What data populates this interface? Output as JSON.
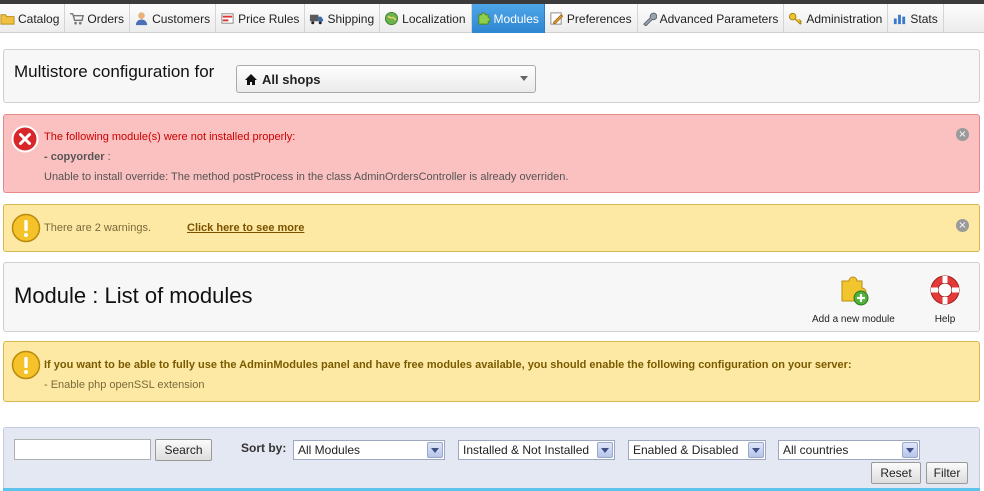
{
  "menu": {
    "tabs": [
      {
        "label": "Catalog",
        "icon": "folder-icon"
      },
      {
        "label": "Orders",
        "icon": "cart-icon"
      },
      {
        "label": "Customers",
        "icon": "user-icon"
      },
      {
        "label": "Price Rules",
        "icon": "price-tag-icon"
      },
      {
        "label": "Shipping",
        "icon": "truck-icon"
      },
      {
        "label": "Localization",
        "icon": "globe-icon"
      },
      {
        "label": "Modules",
        "icon": "puzzle-icon"
      },
      {
        "label": "Preferences",
        "icon": "preferences-icon"
      },
      {
        "label": "Advanced Parameters",
        "icon": "wrench-icon"
      },
      {
        "label": "Administration",
        "icon": "key-icon"
      },
      {
        "label": "Stats",
        "icon": "bar-chart-icon"
      }
    ],
    "active_tab": "Modules"
  },
  "multistore": {
    "title": "Multistore configuration for",
    "selected": "All shops",
    "icon": "home-icon"
  },
  "error": {
    "line1": "The following module(s) were not installed properly:",
    "module_name": "- copyorder",
    "module_suffix": " :",
    "line3": "Unable to install override: The method postProcess in the class AdminOrdersController is already overriden.",
    "colors": {
      "background": "#fbc0c0",
      "text": "#cc0000"
    }
  },
  "warning": {
    "text": "There are 2 warnings.",
    "link": "Click here to see more"
  },
  "module_list": {
    "title": "Module : List of modules",
    "add_label": "Add a new module",
    "help_label": "Help"
  },
  "info": {
    "line1": "If you want to be able to fully use the AdminModules panel and have free modules available, you should enable the following configuration on your server:",
    "line2": "- Enable php openSSL extension"
  },
  "filter": {
    "search_value": "",
    "search_button": "Search",
    "sort_by_label": "Sort by:",
    "sort_by_value": "All Modules",
    "install_value": "Installed & Not Installed",
    "enabled_value": "Enabled & Disabled",
    "country_value": "All countries",
    "reset_button": "Reset",
    "filter_button": "Filter"
  }
}
